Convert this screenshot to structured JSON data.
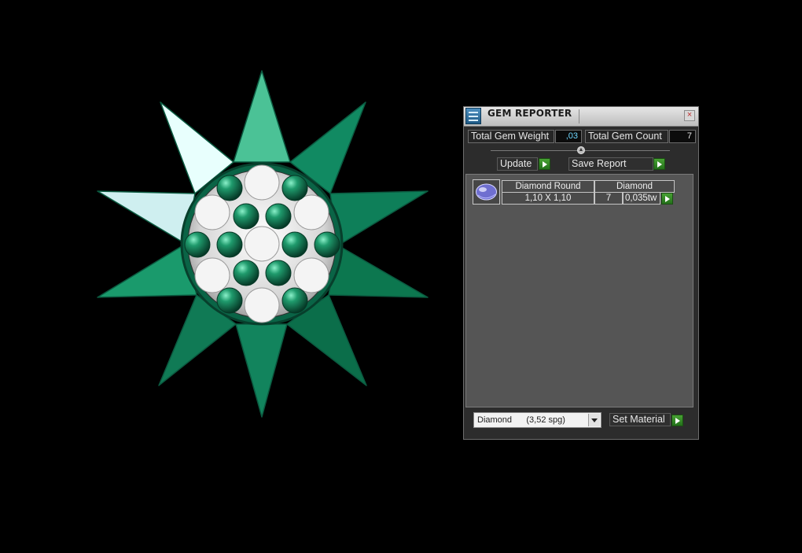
{
  "panel": {
    "title": "GEM REPORTER",
    "close_label": "×",
    "stats": {
      "total_weight_label": "Total Gem Weight",
      "total_weight_value": ",03",
      "total_count_label": "Total Gem Count",
      "total_count_value": "7"
    },
    "buttons": {
      "update": "Update",
      "save_report": "Save Report",
      "set_material": "Set Material"
    },
    "gem_list": [
      {
        "name": "Diamond Round",
        "size": "1,10 X 1,10",
        "material": "Diamond",
        "count": "7",
        "weight": "0,035tw"
      }
    ],
    "material_select": {
      "selected": "Diamond      (3,52 spg)"
    }
  },
  "colors": {
    "viewport_background": "#000000",
    "ring_metal": "#0e7a57",
    "ring_metal_light": "#4bc296",
    "ring_highlight": "#e6fffb",
    "button_green": "#3a9a2a"
  },
  "icons": {
    "window_icon": "gem-reporter-icon",
    "close": "close-icon",
    "collapse": "chevron-up-icon",
    "arrow": "play-arrow-icon",
    "dropdown": "chevron-down-icon",
    "gem": "round-gem-icon"
  }
}
